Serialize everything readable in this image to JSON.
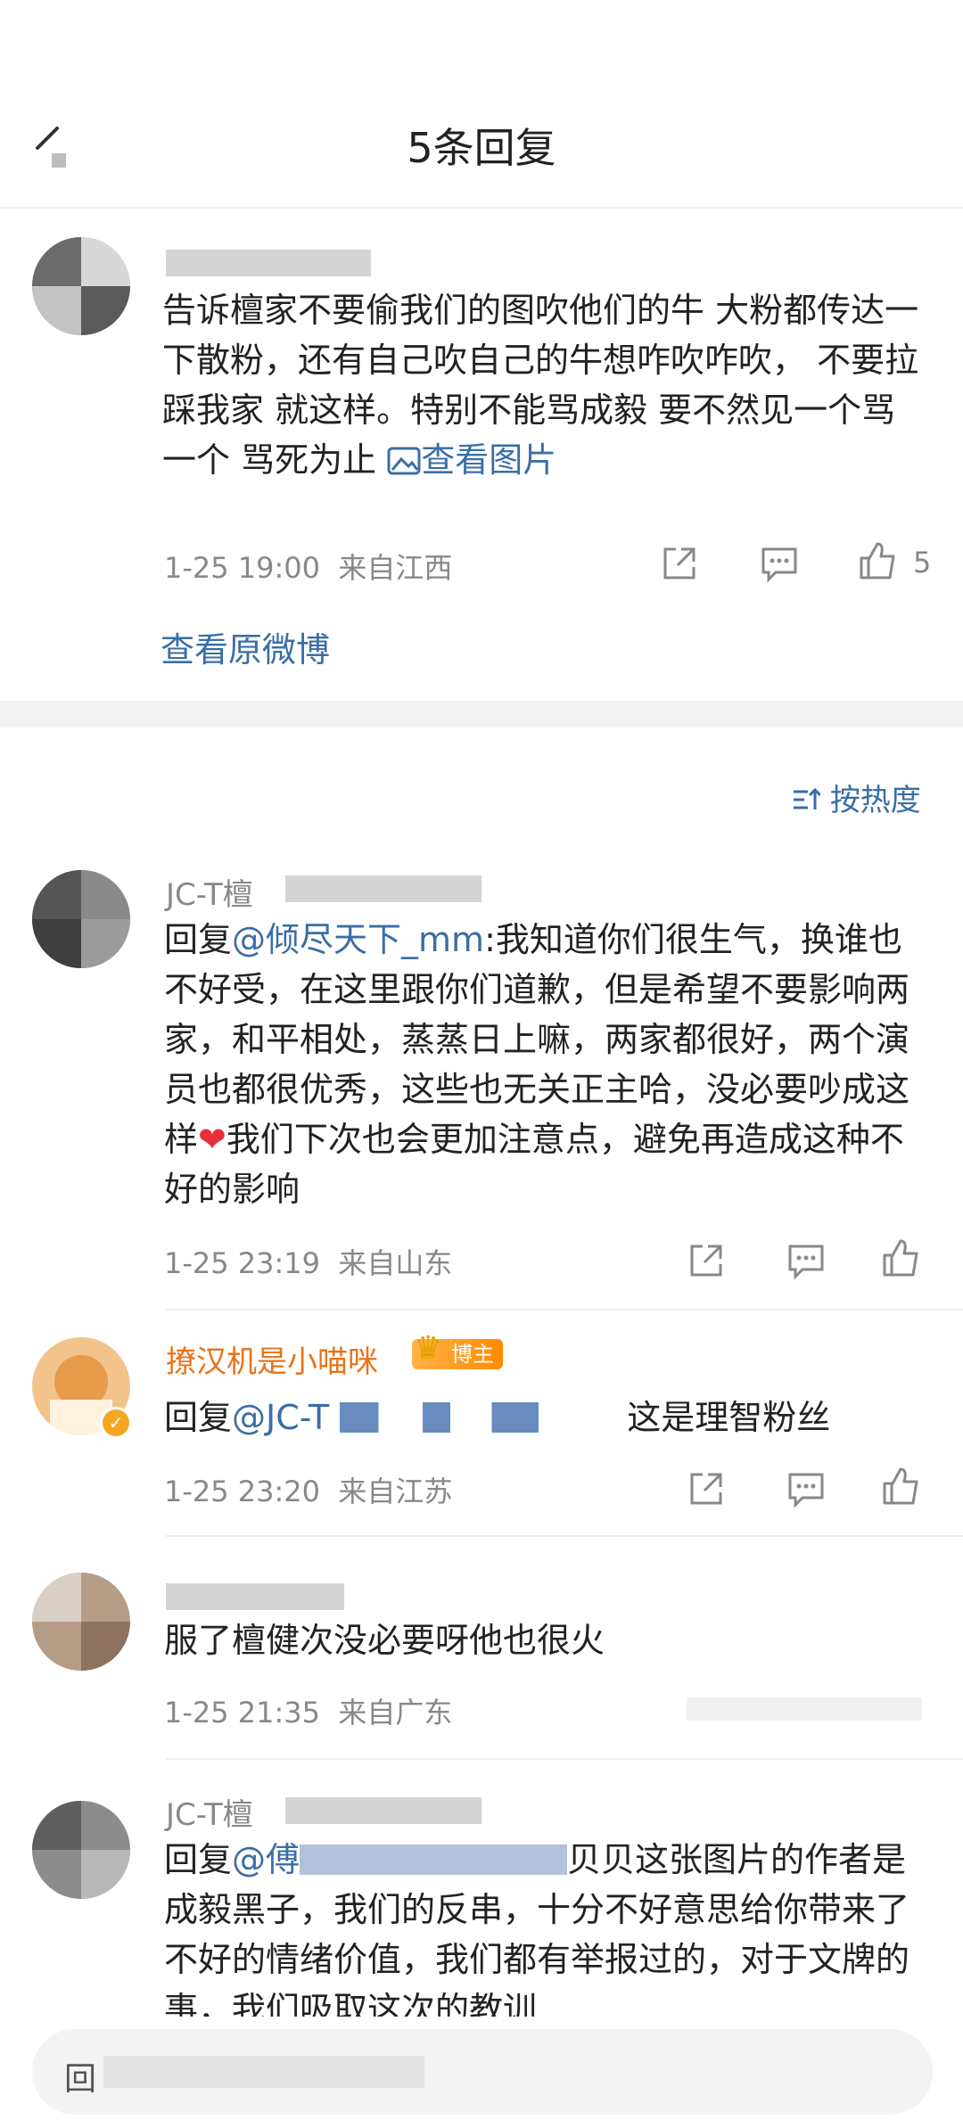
{
  "header": {
    "title": "5条回复"
  },
  "main_comment": {
    "text": "告诉檀家不要偷我们的图吹他们的牛 大粉都传达一下散粉，还有自己吹自己的牛想咋吹咋吹， 不要拉踩我家 就这样。特别不能骂成毅 要不然见一个骂一个 骂死为止",
    "image_link": "查看图片",
    "time": "1-25 19:00",
    "location": "来自江西",
    "like_count": "5",
    "view_original": "查看原微博"
  },
  "sort": {
    "label": "按热度"
  },
  "replies": [
    {
      "username": "JC-T檀",
      "reply_prefix": "回复",
      "mention": "@倾尽天下_mm",
      "text": ":我知道你们很生气，换谁也不好受，在这里跟你们道歉，但是希望不要影响两家，和平相处，蒸蒸日上嘛，两家都很好，两个演员也都很优秀，这些也无关正主哈，没必要吵成这样",
      "text_after_heart": "我们下次也会更加注意点，避免再造成这种不好的影响",
      "time": "1-25 23:19",
      "location": "来自山东"
    },
    {
      "username": "撩汉机是小喵咪",
      "badge": "博主",
      "reply_prefix": "回复",
      "mention": "@JC-T",
      "text": "这是理智粉丝",
      "time": "1-25 23:20",
      "location": "来自江苏"
    },
    {
      "text": "服了檀健次没必要呀他也很火",
      "time": "1-25 21:35",
      "location": "来自广东"
    },
    {
      "username": "JC-T檀",
      "reply_prefix": "回复",
      "mention": "@傅",
      "text": "贝贝这张图片的作者是成毅黑子，我们的反串，十分不好意思给你带来了不好的情绪价值，我们都有举报过的，对于文牌的事，我们吸取这次的教训"
    }
  ],
  "bottom": {
    "input_label": "回"
  },
  "colors": {
    "link": "#3a6ea5",
    "username_orange": "#e8731a",
    "heart": "#e8303a"
  },
  "icons": [
    "back-icon",
    "share-icon",
    "comment-icon",
    "like-icon",
    "sort-icon",
    "image-icon",
    "heart-emoji",
    "verified-badge-icon",
    "crown-icon"
  ]
}
